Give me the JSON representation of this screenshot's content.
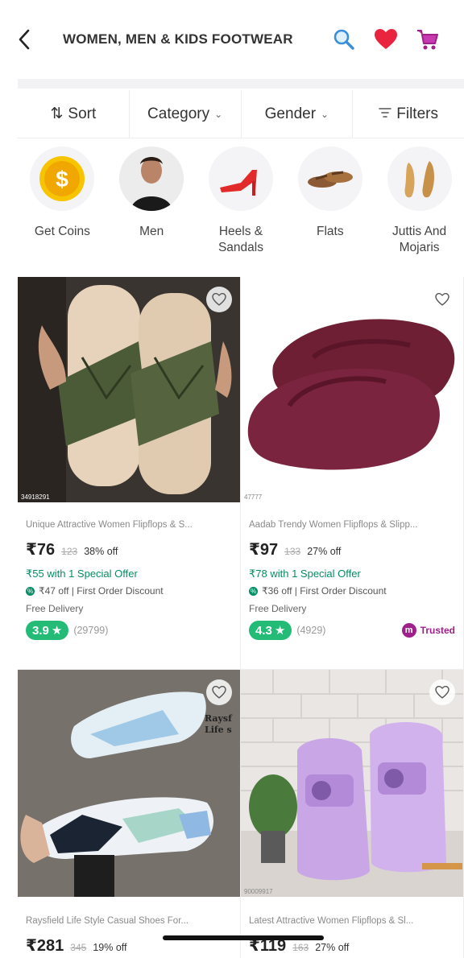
{
  "header": {
    "title": "WOMEN, MEN & KIDS FOOTWEAR",
    "back_icon": "chevron-left-icon",
    "icons": [
      "search-icon",
      "heart-icon",
      "cart-icon"
    ],
    "accent": "#9f2089"
  },
  "filters": {
    "sort": "Sort",
    "category": "Category",
    "gender": "Gender",
    "filters": "Filters"
  },
  "categories": [
    {
      "label": "Get Coins",
      "icon": "coin-icon"
    },
    {
      "label": "Men",
      "icon": "man-avatar"
    },
    {
      "label": "Heels & Sandals",
      "icon": "heel-sandal-image"
    },
    {
      "label": "Flats",
      "icon": "flats-image"
    },
    {
      "label": "Juttis And Mojaris",
      "icon": "jutti-image"
    }
  ],
  "products": [
    {
      "name": "Unique Attractive Women Flipflops & S...",
      "price": "₹76",
      "mrp": "123",
      "off": "38% off",
      "offer": "₹55 with 1 Special Offer",
      "discount": "₹47 off | First Order Discount",
      "delivery": "Free Delivery",
      "rating": "3.9",
      "reviews": "(29799)",
      "code": "34918291"
    },
    {
      "name": "Aadab Trendy Women Flipflops & Slipp...",
      "price": "₹97",
      "mrp": "133",
      "off": "27% off",
      "offer": "₹78 with 1 Special Offer",
      "discount": "₹36 off | First Order Discount",
      "delivery": "Free Delivery",
      "rating": "4.3",
      "reviews": "(4929)",
      "badge": "Trusted",
      "code": "47777"
    },
    {
      "name": "Raysfield Life Style Casual Shoes For...",
      "price": "₹281",
      "mrp": "345",
      "off": "19% off",
      "overlay": "Raysf Life s"
    },
    {
      "name": "Latest Attractive Women Flipflops & Sl...",
      "price": "₹119",
      "mrp": "163",
      "off": "27% off",
      "code": "90009917"
    }
  ]
}
